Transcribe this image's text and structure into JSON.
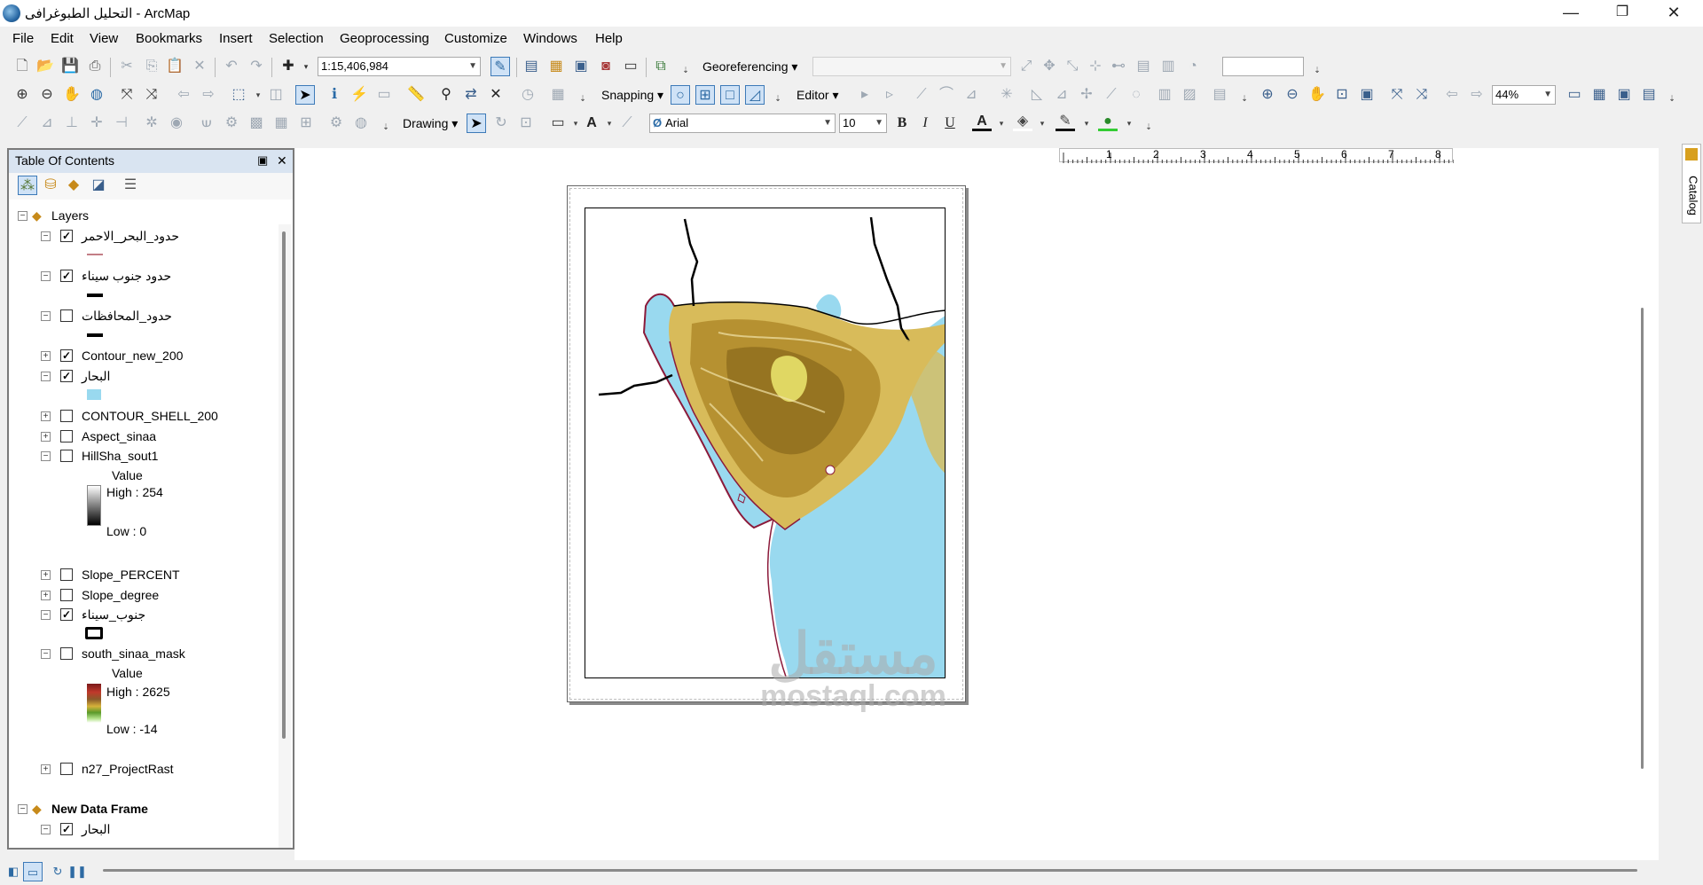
{
  "window": {
    "title": "التحليل الطبوغرافى - ArcMap",
    "minimize": "—",
    "restore": "❐",
    "close": "✕"
  },
  "menus": [
    "File",
    "Edit",
    "View",
    "Bookmarks",
    "Insert",
    "Selection",
    "Geoprocessing",
    "Customize",
    "Windows",
    "Help"
  ],
  "toolbar": {
    "scale": "1:15,406,984",
    "georeferencing_label": "Georeferencing ▾",
    "snapping_label": "Snapping ▾",
    "editor_label": "Editor ▾",
    "zoom_percent": "44%",
    "drawing_label": "Drawing ▾",
    "font_name": "Arial",
    "font_size": "10",
    "bold": "B",
    "italic": "I",
    "underline": "U",
    "font_color_icon": "A"
  },
  "ruler": {
    "ticks": [
      "1",
      "2",
      "3",
      "4",
      "5",
      "6",
      "7",
      "8"
    ]
  },
  "toc": {
    "title": "Table Of Contents",
    "pin": "▣",
    "close": "✕",
    "root_label": "Layers",
    "layers": [
      {
        "name": "حدود_البحر_الاحمر",
        "checked": true,
        "expanded": true,
        "symbol": "line-thin-red"
      },
      {
        "name": "حدود جنوب سيناء",
        "checked": true,
        "expanded": true,
        "symbol": "line-thick-black"
      },
      {
        "name": "حدود_المحافظات",
        "checked": false,
        "expanded": true,
        "symbol": "line-thick-black"
      },
      {
        "name": "Contour_new_200",
        "checked": true,
        "expanded": false
      },
      {
        "name": "البحار",
        "checked": true,
        "expanded": true,
        "symbol": "fill-blue"
      },
      {
        "name": "CONTOUR_SHELL_200",
        "checked": false,
        "expanded": false
      },
      {
        "name": "Aspect_sinaa",
        "checked": false,
        "expanded": false
      },
      {
        "name": "HillSha_sout1",
        "checked": false,
        "expanded": true,
        "legend": {
          "title": "Value",
          "high": "High : 254",
          "low": "Low : 0"
        }
      },
      {
        "name": "Slope_PERCENT",
        "checked": false,
        "expanded": false
      },
      {
        "name": "Slope_degree",
        "checked": false,
        "expanded": false
      },
      {
        "name": "جنوب_سيناء",
        "checked": true,
        "expanded": true,
        "symbol": "box-outline"
      },
      {
        "name": "south_sinaa_mask",
        "checked": false,
        "expanded": true,
        "legend": {
          "title": "Value",
          "high": "High : 2625",
          "low": "Low : -14"
        }
      },
      {
        "name": "n27_ProjectRast",
        "checked": false,
        "expanded": false
      }
    ],
    "second_frame": "New Data Frame",
    "second_frame_layer": "البحار"
  },
  "side_panel": {
    "catalog_label": "Catalog"
  },
  "watermark": {
    "arabic": "مستقل",
    "latin": "mostaql.com"
  },
  "colors": {
    "sea": "#99d9ef",
    "land_dark": "#b08a2a",
    "land_light": "#e6cf7a",
    "boundary_red": "#8b1a3a",
    "toc_header": "#d9e4f1"
  }
}
